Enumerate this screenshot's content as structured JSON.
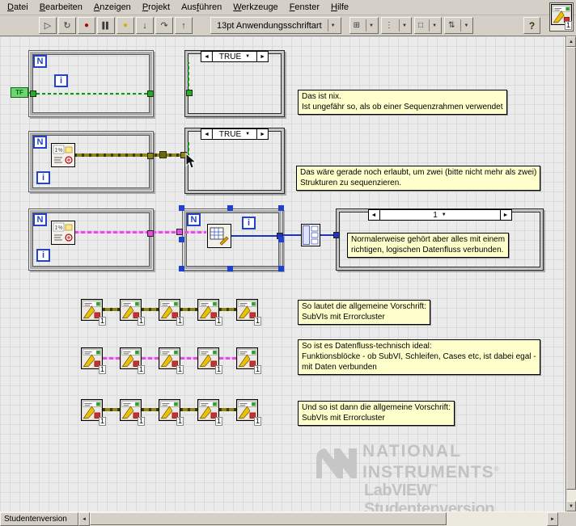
{
  "app": {
    "vi_number": "1"
  },
  "menubar": {
    "items": [
      {
        "label": "Datei",
        "accel": 0
      },
      {
        "label": "Bearbeiten",
        "accel": 0
      },
      {
        "label": "Anzeigen",
        "accel": 0
      },
      {
        "label": "Projekt",
        "accel": 0
      },
      {
        "label": "Ausführen",
        "accel": 3
      },
      {
        "label": "Werkzeuge",
        "accel": 0
      },
      {
        "label": "Fenster",
        "accel": 0
      },
      {
        "label": "Hilfe",
        "accel": 0
      }
    ]
  },
  "toolbar": {
    "buttons": [
      {
        "name": "run",
        "glyph": "▷"
      },
      {
        "name": "run-continuous",
        "glyph": "↻"
      },
      {
        "name": "abort",
        "glyph": "●"
      },
      {
        "name": "pause",
        "glyph": "▌▌"
      },
      {
        "name": "highlight-execution",
        "glyph": "●"
      },
      {
        "name": "step-into",
        "glyph": "↓"
      },
      {
        "name": "step-over",
        "glyph": "↷"
      },
      {
        "name": "step-out",
        "glyph": "↑"
      }
    ],
    "font_selector": "13pt Anwendungsschriftart",
    "dropdowns": [
      {
        "name": "align-objects",
        "glyph": "⊞"
      },
      {
        "name": "distribute-objects",
        "glyph": "⋮"
      },
      {
        "name": "resize-objects",
        "glyph": "□"
      },
      {
        "name": "reorder",
        "glyph": "⇅"
      }
    ],
    "help_label": "?"
  },
  "glyphs": {
    "left": "◄",
    "right": "►",
    "down": "▼",
    "up": "▲"
  },
  "terminals": {
    "count": "N",
    "iteration": "i",
    "bool_const": "TF"
  },
  "cases": {
    "case1": "TRUE",
    "case2": "TRUE",
    "case3": "1"
  },
  "comments": {
    "note1": [
      "Das ist nix.",
      "Ist ungefähr so, als ob einer Sequenzrahmen verwendet"
    ],
    "note2": [
      "Das wäre gerade noch erlaubt, um zwei (bitte nicht mehr als zwei)",
      "Strukturen zu sequenzieren."
    ],
    "note3": [
      "Normalerweise gehört aber alles mit einem",
      "richtigen, logischen Datenfluss verbunden."
    ],
    "note4": [
      "So lautet die allgemeine Vorschrift:",
      "SubVIs mit Errorcluster"
    ],
    "note5": [
      "So ist es Datenfluss-technisch ideal:",
      "Funktionsblöcke - ob SubVI, Schleifen, Cases etc, ist dabei egal -",
      "mit Daten verbunden"
    ],
    "note6": [
      "Und so ist dann die allgemeine Vorschrift:",
      "SubVIs mit Errorcluster"
    ]
  },
  "watermark": {
    "brand_line1": "NATIONAL",
    "brand_line2": "INSTRUMENTS",
    "registered": "®",
    "product": "LabVIEW",
    "trademark": "™",
    "edition": "Studentenversion"
  },
  "statusbar": {
    "edition": "Studentenversion"
  },
  "colors": {
    "chrome": "#d4d0c8",
    "diagram_background": "#ebebeb",
    "comment_background": "#ffffcc",
    "wire_boolean": "#00a000",
    "wire_error_cluster": "#8c8618",
    "wire_cluster": "#e050e0",
    "wire_numeric": "#2233bb",
    "selection_blue": "#2040d0"
  }
}
